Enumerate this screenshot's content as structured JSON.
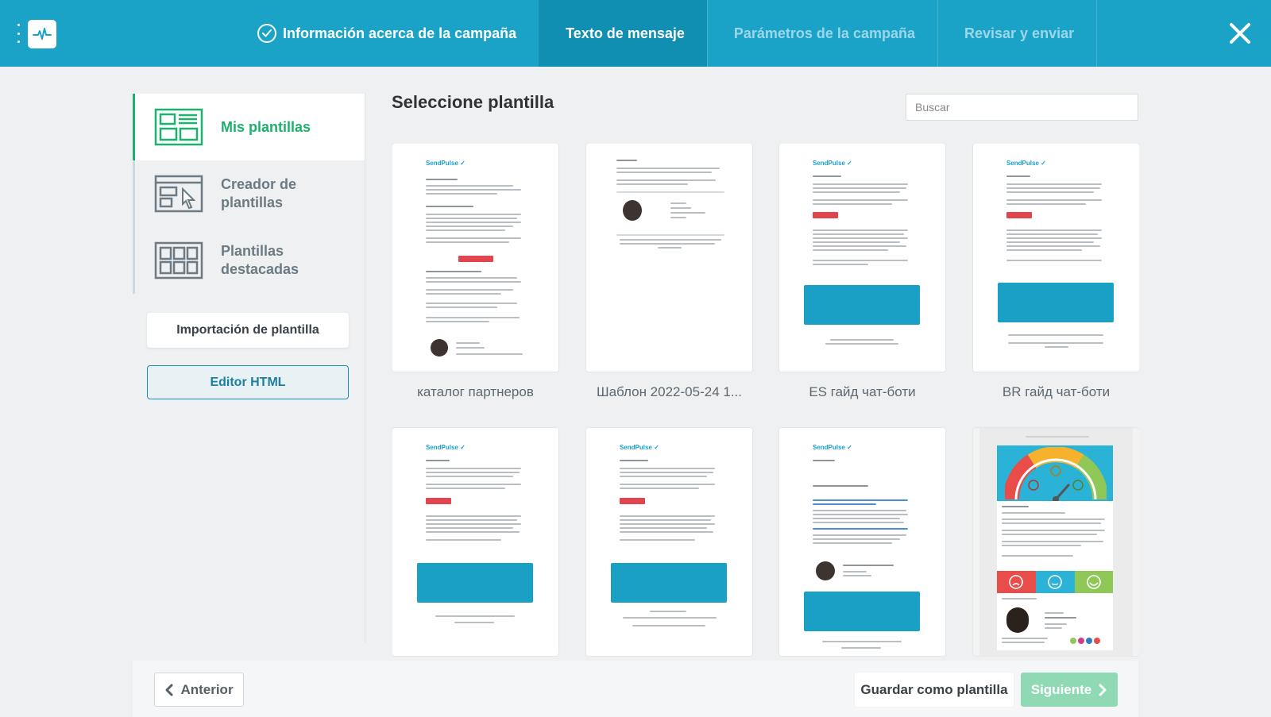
{
  "header": {
    "steps": [
      {
        "label": "Información acerca de la campaña",
        "state": "done"
      },
      {
        "label": "Texto de mensaje",
        "state": "active"
      },
      {
        "label": "Parámetros de la campaña",
        "state": "pending"
      },
      {
        "label": "Revisar y enviar",
        "state": "pending"
      }
    ],
    "icons": {
      "menu": "dots-vertical-icon",
      "logo": "pulse-logo-icon",
      "close": "close-icon",
      "check": "check-circle-icon"
    }
  },
  "sidebar": {
    "items": [
      {
        "label": "Mis plantillas",
        "icon": "my-templates-icon",
        "active": true
      },
      {
        "label": "Creador de plantillas",
        "icon": "template-builder-icon",
        "active": false
      },
      {
        "label": "Plantillas destacadas",
        "icon": "featured-templates-icon",
        "active": false
      }
    ],
    "import_label": "Importación de plantilla",
    "html_editor_label": "Editor HTML"
  },
  "main": {
    "title": "Seleccione plantilla",
    "search_placeholder": "Buscar",
    "templates": [
      {
        "label": "каталог партнеров",
        "logo": "SendPulse"
      },
      {
        "label": "Шаблон 2022-05-24 1...",
        "logo": ""
      },
      {
        "label": "ES гайд чат-боти",
        "logo": "SendPulse"
      },
      {
        "label": "BR гайд чат-боти",
        "logo": "SendPulse"
      },
      {
        "label": "",
        "logo": "SendPulse"
      },
      {
        "label": "",
        "logo": "SendPulse"
      },
      {
        "label": "",
        "logo": "SendPulse"
      },
      {
        "label": "",
        "logo": ""
      }
    ]
  },
  "footer": {
    "prev_label": "Anterior",
    "save_label": "Guardar como plantilla",
    "next_label": "Siguiente"
  },
  "colors": {
    "header_bg": "#1aa3c7",
    "header_active": "#118fb2",
    "accent_green": "#1cb16d",
    "next_button": "#8fd9b4"
  }
}
